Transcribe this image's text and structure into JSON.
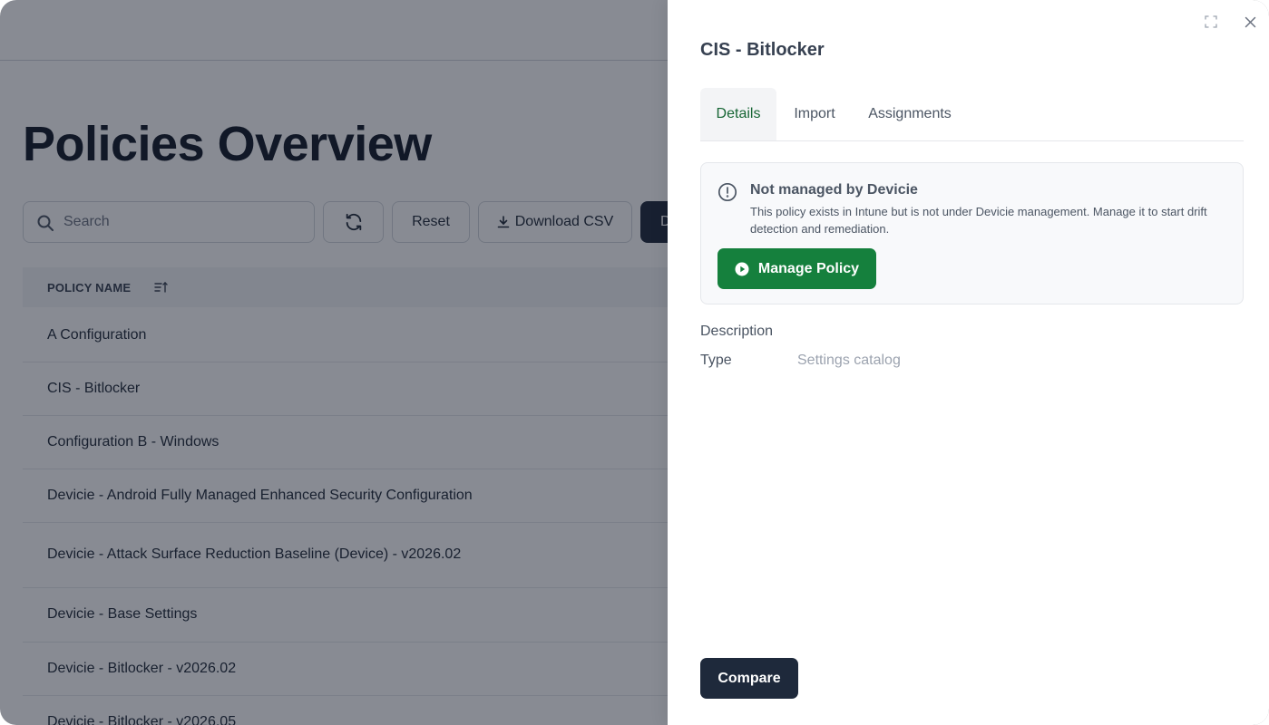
{
  "background": {
    "page_title": "Policies Overview",
    "search": {
      "placeholder": "Search",
      "value": ""
    },
    "toolbar": {
      "reset_label": "Reset",
      "download_label": "Download CSV",
      "dark_button_label": "D"
    },
    "table": {
      "header": "POLICY NAME",
      "rows": [
        "A Configuration",
        "CIS - Bitlocker",
        "Configuration B - Windows",
        "Devicie - Android Fully Managed Enhanced Security Configuration",
        "Devicie - Attack Surface Reduction Baseline (Device) - v2026.02",
        "Devicie - Base Settings",
        "Devicie - Bitlocker - v2026.02",
        "Devicie - Bitlocker - v2026.05"
      ]
    }
  },
  "drawer": {
    "title": "CIS - Bitlocker",
    "tabs": [
      {
        "label": "Details",
        "active": true
      },
      {
        "label": "Import",
        "active": false
      },
      {
        "label": "Assignments",
        "active": false
      }
    ],
    "notice": {
      "title": "Not managed by Devicie",
      "body": "This policy exists in Intune but is not under Devicie management. Manage it to start drift detection and remediation.",
      "button_label": "Manage Policy"
    },
    "fields": {
      "description_label": "Description",
      "description_value": "",
      "type_label": "Type",
      "type_value": "Settings catalog"
    },
    "compare_label": "Compare"
  },
  "colors": {
    "brand_green": "#15803d",
    "active_tab_text": "#166534",
    "dark_button": "#1e293b",
    "overlay": "rgba(17,24,39,0.5)"
  },
  "icons": [
    "search-icon",
    "refresh-icon",
    "download-icon",
    "sort-icon",
    "expand-icon",
    "close-icon",
    "info-icon",
    "play-icon"
  ]
}
